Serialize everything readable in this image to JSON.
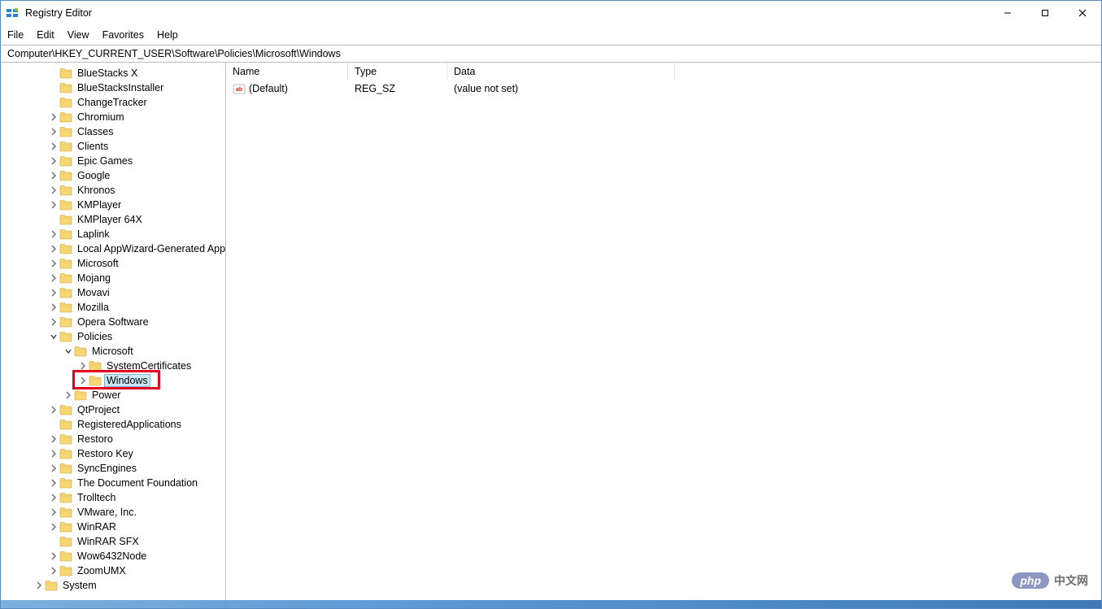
{
  "window": {
    "title": "Registry Editor"
  },
  "menu": [
    "File",
    "Edit",
    "View",
    "Favorites",
    "Help"
  ],
  "address": "Computer\\HKEY_CURRENT_USER\\Software\\Policies\\Microsoft\\Windows",
  "columns": {
    "name": "Name",
    "type": "Type",
    "data": "Data"
  },
  "values": [
    {
      "name": "(Default)",
      "type": "REG_SZ",
      "data": "(value not set)"
    }
  ],
  "tree": [
    {
      "label": "BlueStacks X",
      "indent": 58,
      "expander": "none"
    },
    {
      "label": "BlueStacksInstaller",
      "indent": 58,
      "expander": "none"
    },
    {
      "label": "ChangeTracker",
      "indent": 58,
      "expander": "none"
    },
    {
      "label": "Chromium",
      "indent": 58,
      "expander": "closed"
    },
    {
      "label": "Classes",
      "indent": 58,
      "expander": "closed"
    },
    {
      "label": "Clients",
      "indent": 58,
      "expander": "closed"
    },
    {
      "label": "Epic Games",
      "indent": 58,
      "expander": "closed"
    },
    {
      "label": "Google",
      "indent": 58,
      "expander": "closed"
    },
    {
      "label": "Khronos",
      "indent": 58,
      "expander": "closed"
    },
    {
      "label": "KMPlayer",
      "indent": 58,
      "expander": "closed"
    },
    {
      "label": "KMPlayer 64X",
      "indent": 58,
      "expander": "none"
    },
    {
      "label": "Laplink",
      "indent": 58,
      "expander": "closed"
    },
    {
      "label": "Local AppWizard-Generated Applications",
      "indent": 58,
      "expander": "closed"
    },
    {
      "label": "Microsoft",
      "indent": 58,
      "expander": "closed"
    },
    {
      "label": "Mojang",
      "indent": 58,
      "expander": "closed"
    },
    {
      "label": "Movavi",
      "indent": 58,
      "expander": "closed"
    },
    {
      "label": "Mozilla",
      "indent": 58,
      "expander": "closed"
    },
    {
      "label": "Opera Software",
      "indent": 58,
      "expander": "closed"
    },
    {
      "label": "Policies",
      "indent": 58,
      "expander": "open"
    },
    {
      "label": "Microsoft",
      "indent": 76,
      "expander": "open"
    },
    {
      "label": "SystemCertificates",
      "indent": 94,
      "expander": "closed"
    },
    {
      "label": "Windows",
      "indent": 94,
      "expander": "closed",
      "selected": true,
      "highlighted": true
    },
    {
      "label": "Power",
      "indent": 76,
      "expander": "closed"
    },
    {
      "label": "QtProject",
      "indent": 58,
      "expander": "closed"
    },
    {
      "label": "RegisteredApplications",
      "indent": 58,
      "expander": "none"
    },
    {
      "label": "Restoro",
      "indent": 58,
      "expander": "closed"
    },
    {
      "label": "Restoro Key",
      "indent": 58,
      "expander": "closed"
    },
    {
      "label": "SyncEngines",
      "indent": 58,
      "expander": "closed"
    },
    {
      "label": "The Document Foundation",
      "indent": 58,
      "expander": "closed"
    },
    {
      "label": "Trolltech",
      "indent": 58,
      "expander": "closed"
    },
    {
      "label": "VMware, Inc.",
      "indent": 58,
      "expander": "closed"
    },
    {
      "label": "WinRAR",
      "indent": 58,
      "expander": "closed"
    },
    {
      "label": "WinRAR SFX",
      "indent": 58,
      "expander": "none"
    },
    {
      "label": "Wow6432Node",
      "indent": 58,
      "expander": "closed"
    },
    {
      "label": "ZoomUMX",
      "indent": 58,
      "expander": "closed"
    },
    {
      "label": "System",
      "indent": 40,
      "expander": "closed"
    }
  ],
  "watermark": {
    "badge": "php",
    "text": "中文网"
  }
}
